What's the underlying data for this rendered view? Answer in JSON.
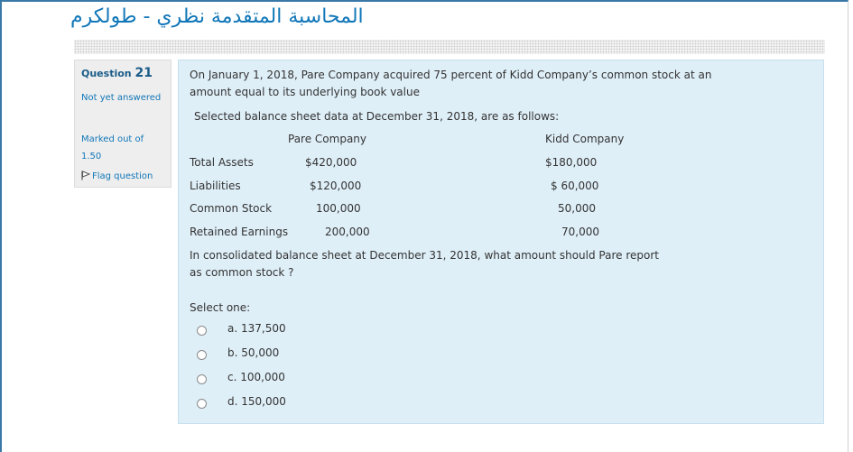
{
  "course": {
    "title": "المحاسبة المتقدمة نظري - طولكرم"
  },
  "question_info": {
    "label": "Question",
    "number": "21",
    "state": "Not yet answered",
    "marks": "Marked out of 1.50",
    "flag_label": "Flag question"
  },
  "question": {
    "intro_line1": "On January 1, 2018, Pare Company acquired 75 percent of Kidd Company’s  common stock at an",
    "intro_line2": "amount equal to its underlying book value",
    "data_intro": "Selected balance sheet data at December 31, 2018, are as follows:",
    "columns": [
      "Pare Company",
      "Kidd Company"
    ],
    "rows": [
      {
        "label": "Total Assets",
        "pare": "$420,000",
        "kidd": "$180,000"
      },
      {
        "label": "Liabilities",
        "pare": "$120,000",
        "kidd": "$ 60,000"
      },
      {
        "label": "Common Stock",
        "pare": "100,000",
        "kidd": "50,000"
      },
      {
        "label": "Retained Earnings",
        "pare": "200,000",
        "kidd": "70,000"
      }
    ],
    "prompt_line1": "In  consolidated balance sheet at December 31, 2018, what amount should Pare report",
    "prompt_line2": "as common stock ?",
    "select_label": "Select one:",
    "options": [
      {
        "label": "a. 137,500"
      },
      {
        "label": "b. 50,000"
      },
      {
        "label": "c. 100,000"
      },
      {
        "label": "d. 150,000"
      }
    ]
  },
  "colors": {
    "accent": "#1177b8",
    "question_bg": "#dfeff8",
    "info_bg": "#eeeeee"
  }
}
